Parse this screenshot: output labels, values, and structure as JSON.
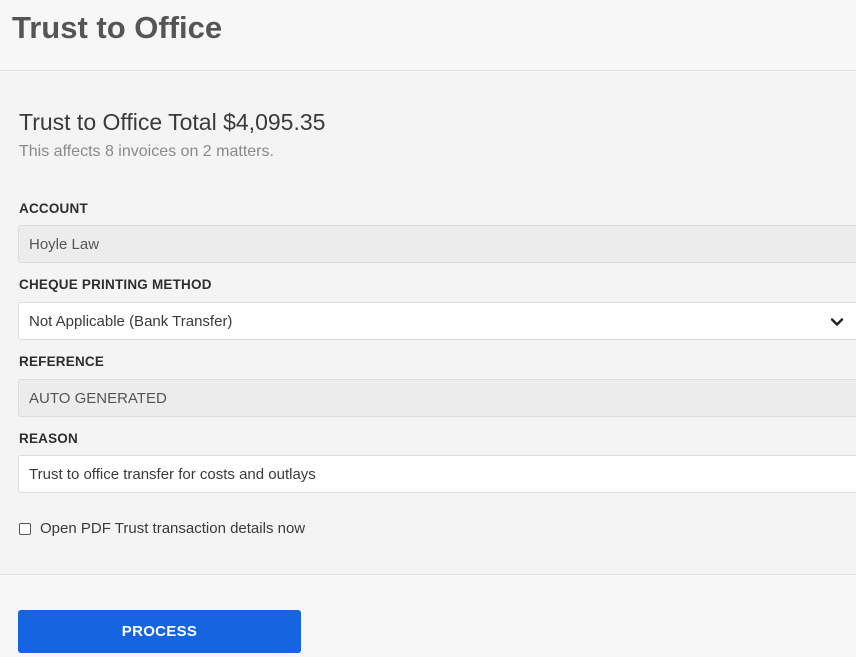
{
  "header": {
    "title": "Trust to Office"
  },
  "summary": {
    "total_text": "Trust to Office Total $4,095.35",
    "affects_text": "This affects 8 invoices on 2 matters."
  },
  "fields": {
    "account": {
      "label": "ACCOUNT",
      "value": "Hoyle Law"
    },
    "cheque_method": {
      "label": "CHEQUE PRINTING METHOD",
      "value": "Not Applicable (Bank Transfer)"
    },
    "reference": {
      "label": "REFERENCE",
      "value": "AUTO GENERATED"
    },
    "reason": {
      "label": "REASON",
      "value": "Trust to office transfer for costs and outlays"
    }
  },
  "options": {
    "open_pdf_label": "Open PDF Trust transaction details now",
    "open_pdf_checked": false
  },
  "footer": {
    "process_label": "PROCESS"
  },
  "colors": {
    "primary": "#1565e0",
    "background": "#f4f4f4",
    "readonly_field": "#ececec"
  }
}
